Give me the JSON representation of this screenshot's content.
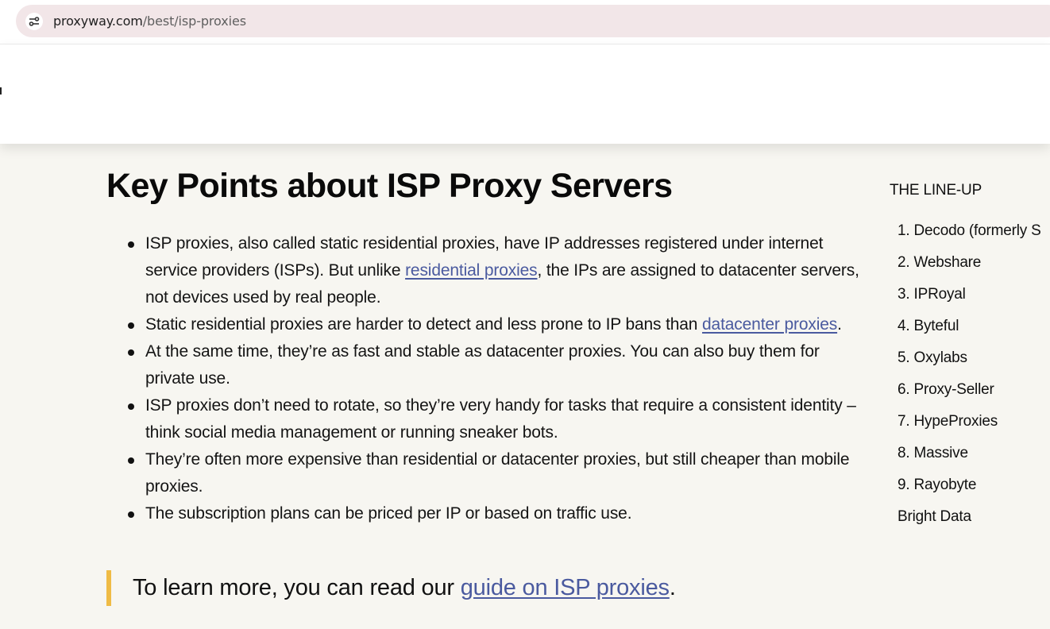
{
  "browser": {
    "url_host": "proxyway.com",
    "url_path": "/best/isp-proxies"
  },
  "article": {
    "title": "Key Points about ISP Proxy Servers",
    "points": [
      {
        "pre": "ISP proxies, also called static residential proxies, have IP addresses registered under internet service providers (ISPs). But unlike ",
        "link": "residential proxies",
        "post": ", the IPs are assigned to datacenter servers, not devices used by real people."
      },
      {
        "pre": "Static residential proxies are harder to detect and less prone to IP bans than ",
        "link": "datacenter proxies",
        "post": "."
      },
      {
        "text": "At the same time, they’re as fast and stable as datacenter proxies. You can also buy them for private use."
      },
      {
        "text": "ISP proxies don’t need to rotate, so they’re very handy for tasks that require a consistent identity – think social media management or running sneaker bots."
      },
      {
        "text": "They’re often more expensive than residential or datacenter proxies, but still cheaper than mobile proxies."
      },
      {
        "text": "The subscription plans can be priced per IP or based on traffic use."
      }
    ],
    "callout": {
      "pre": "To learn more, you can read our ",
      "link": "guide on ISP proxies",
      "post": "."
    }
  },
  "sidebar": {
    "heading": "THE LINE-UP",
    "items": [
      "1. Decodo (formerly S",
      "2. Webshare",
      "3. IPRoyal",
      "4. Byteful",
      "5. Oxylabs",
      "6. Proxy-Seller",
      "7. HypeProxies",
      "8. Massive",
      "9. Rayobyte",
      "Bright Data"
    ]
  },
  "colors": {
    "page_background": "#f7f6f1",
    "link": "#4a5a9f",
    "callout_accent": "#efbb45",
    "url_bar": "#f2e6e8"
  },
  "icons": {
    "site_info": "site-info-icon"
  }
}
